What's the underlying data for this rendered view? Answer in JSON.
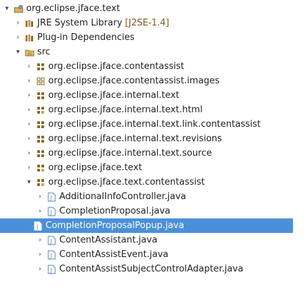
{
  "tree": {
    "project": {
      "twisty": "▾",
      "label": "org.eclipse.jface.text"
    },
    "jre": {
      "twisty": "›",
      "label": "JRE System Library",
      "detail": "[J2SE-1.4]"
    },
    "plugin_deps": {
      "twisty": "›",
      "label": "Plug-in Dependencies"
    },
    "src": {
      "twisty": "▾",
      "label": "src"
    },
    "packages": [
      {
        "twisty": "›",
        "label": "org.eclipse.jface.contentassist"
      },
      {
        "twisty": "›",
        "label": "org.eclipse.jface.contentassist.images"
      },
      {
        "twisty": "›",
        "label": "org.eclipse.jface.internal.text"
      },
      {
        "twisty": "›",
        "label": "org.eclipse.jface.internal.text.html"
      },
      {
        "twisty": "›",
        "label": "org.eclipse.jface.internal.text.link.contentassist"
      },
      {
        "twisty": "›",
        "label": "org.eclipse.jface.internal.text.revisions"
      },
      {
        "twisty": "›",
        "label": "org.eclipse.jface.internal.text.source"
      },
      {
        "twisty": "›",
        "label": "org.eclipse.jface.text"
      }
    ],
    "open_package": {
      "twisty": "▾",
      "label": "org.eclipse.jface.text.contentassist"
    },
    "files": [
      {
        "twisty": "›",
        "label": "AdditionalInfoController.java",
        "selected": false
      },
      {
        "twisty": "›",
        "label": "CompletionProposal.java",
        "selected": false
      },
      {
        "twisty": "",
        "label": "CompletionProposalPopup.java",
        "selected": true
      },
      {
        "twisty": "›",
        "label": "ContentAssistant.java",
        "selected": false
      },
      {
        "twisty": "›",
        "label": "ContentAssistEvent.java",
        "selected": false
      },
      {
        "twisty": "›",
        "label": "ContentAssistSubjectControlAdapter.java",
        "selected": false
      }
    ],
    "colors": {
      "selection": "#4a90d9",
      "package_icon": "#8a6d1a",
      "java_icon": "#5b82b5",
      "library_icon": "#8b6a2c"
    }
  }
}
